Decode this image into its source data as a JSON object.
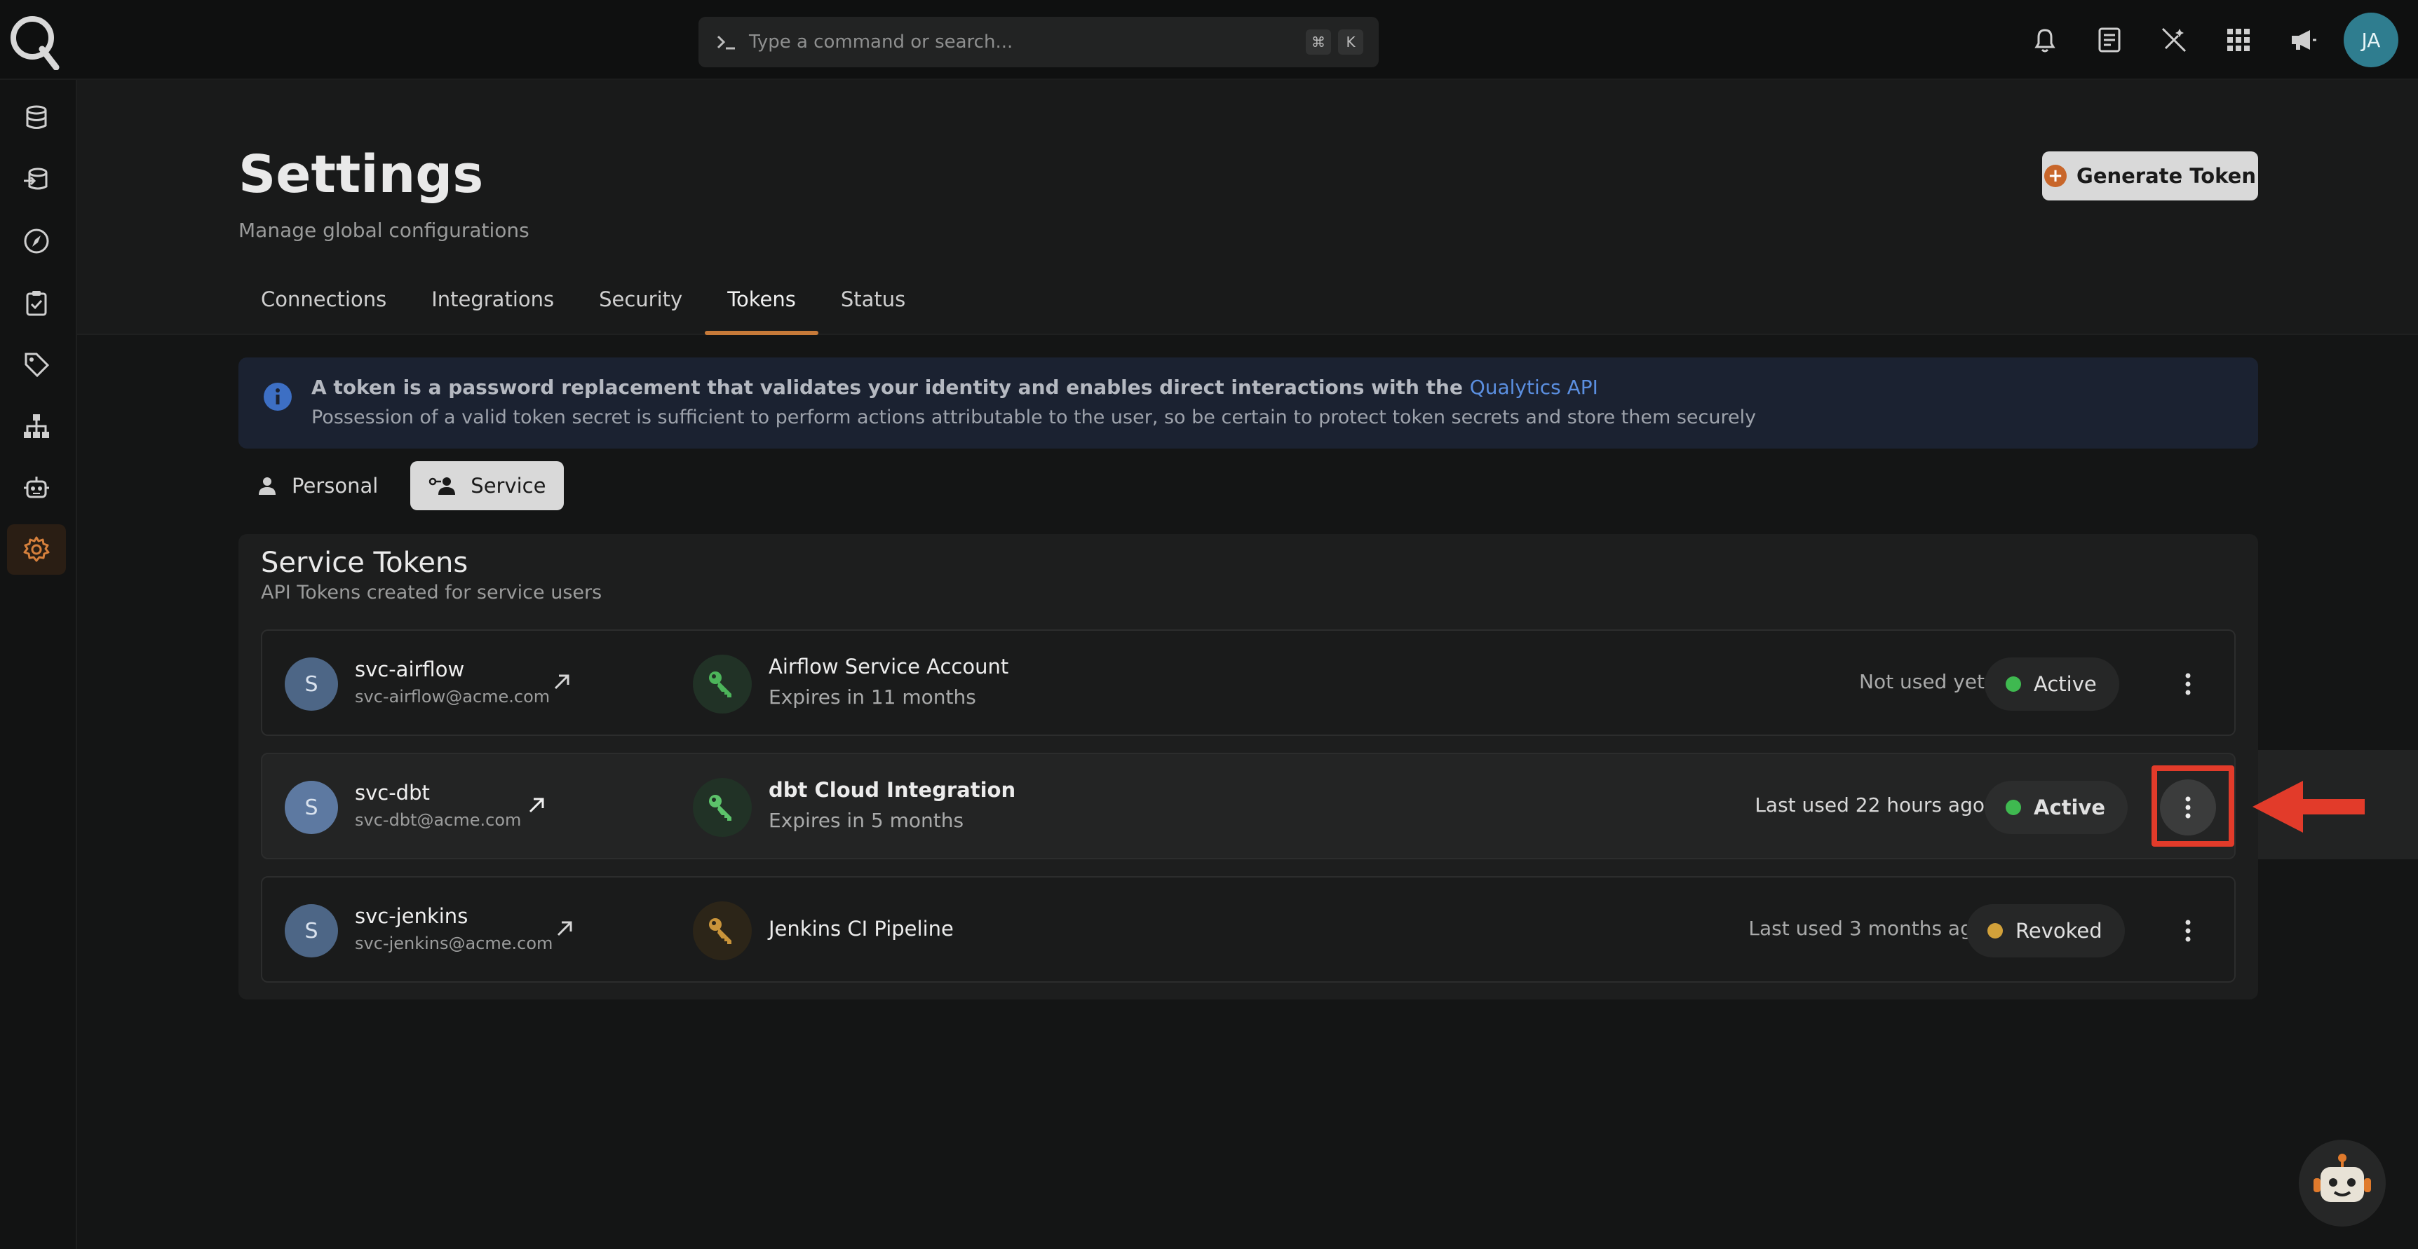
{
  "topbar": {
    "search_placeholder": "Type a command or search...",
    "shortcut_keys": [
      "⌘",
      "K"
    ],
    "user_initials": "JA"
  },
  "page": {
    "title": "Settings",
    "subtitle": "Manage global configurations",
    "generate_label": "Generate Token"
  },
  "tabs": [
    {
      "label": "Connections",
      "active": false
    },
    {
      "label": "Integrations",
      "active": false
    },
    {
      "label": "Security",
      "active": false
    },
    {
      "label": "Tokens",
      "active": true
    },
    {
      "label": "Status",
      "active": false
    }
  ],
  "info": {
    "line1": "A token is a password replacement that validates your identity and enables direct interactions with the",
    "link": "Qualytics API",
    "line2": "Possession of a valid token secret is sufficient to perform actions attributable to the user, so be certain to protect token secrets and store them securely"
  },
  "segments": {
    "personal": "Personal",
    "service": "Service",
    "active": "service"
  },
  "panel": {
    "title": "Service Tokens",
    "subtitle": "API Tokens created for service users"
  },
  "rows": [
    {
      "initial": "S",
      "name": "svc-airflow",
      "email": "svc-airflow@acme.com",
      "token": "Airflow Service Account",
      "expires": "Expires in 11 months",
      "last_used": "Not used yet",
      "status": "Active",
      "status_color": "#3fb950"
    },
    {
      "initial": "S",
      "name": "svc-dbt",
      "email": "svc-dbt@acme.com",
      "token": "dbt Cloud Integration",
      "expires": "Expires in 5 months",
      "last_used": "Last used 22 hours ago",
      "status": "Active",
      "status_color": "#3fb950"
    },
    {
      "initial": "S",
      "name": "svc-jenkins",
      "email": "svc-jenkins@acme.com",
      "token": "Jenkins CI Pipeline",
      "expires": "",
      "last_used": "Last used 3 months ago",
      "status": "Revoked",
      "status_color": "#d2a13a"
    }
  ],
  "colors": {
    "accent": "#c77a39",
    "link": "#5b8fe0",
    "annotation": "#e23b2a"
  }
}
